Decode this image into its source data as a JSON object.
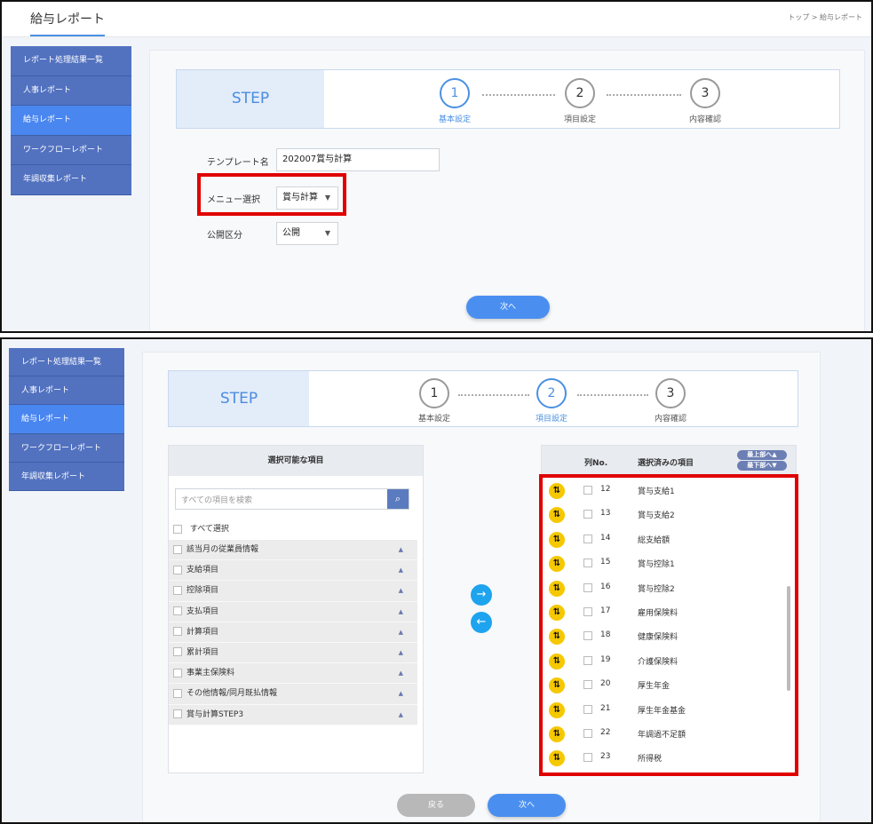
{
  "header": {
    "title": "給与レポート",
    "breadcrumb": "トップ > 給与レポート"
  },
  "sidebar": {
    "items": [
      {
        "label": "レポート処理結果一覧"
      },
      {
        "label": "人事レポート"
      },
      {
        "label": "給与レポート"
      },
      {
        "label": "ワークフローレポート"
      },
      {
        "label": "年調収集レポート"
      }
    ],
    "active_index": 2
  },
  "steps": {
    "label": "STEP",
    "items": [
      {
        "num": "1",
        "name": "基本設定"
      },
      {
        "num": "2",
        "name": "項目設定"
      },
      {
        "num": "3",
        "name": "内容確認"
      }
    ]
  },
  "step1": {
    "current": "1",
    "template_label": "テンプレート名",
    "template_value": "202007賞与計算",
    "menu_label": "メニュー選択",
    "menu_value": "賞与計算",
    "public_label": "公開区分",
    "public_value": "公開",
    "next_label": "次へ"
  },
  "step2": {
    "current": "2",
    "available_title": "選択可能な項目",
    "search_placeholder": "すべての項目を検索",
    "select_all": "すべて選択",
    "categories": [
      "該当月の従業員情報",
      "支給項目",
      "控除項目",
      "支払項目",
      "計算項目",
      "累計項目",
      "事業主保険料",
      "その他情報/同月既払情報",
      "賞与計算STEP3"
    ],
    "selected_col_no": "列No.",
    "selected_title": "選択済みの項目",
    "move_top": "最上部へ▲",
    "move_bottom": "最下部へ▼",
    "selected": [
      {
        "no": "12",
        "name": "賞与支給1"
      },
      {
        "no": "13",
        "name": "賞与支給2"
      },
      {
        "no": "14",
        "name": "総支給額"
      },
      {
        "no": "15",
        "name": "賞与控除1"
      },
      {
        "no": "16",
        "name": "賞与控除2"
      },
      {
        "no": "17",
        "name": "雇用保険料"
      },
      {
        "no": "18",
        "name": "健康保険料"
      },
      {
        "no": "19",
        "name": "介護保険料"
      },
      {
        "no": "20",
        "name": "厚生年金"
      },
      {
        "no": "21",
        "name": "厚生年金基金"
      },
      {
        "no": "22",
        "name": "年調過不足額"
      },
      {
        "no": "23",
        "name": "所得税"
      }
    ],
    "back_label": "戻る",
    "next_label": "次へ"
  },
  "icons": {
    "search": "search-icon",
    "arrow_right": "arrow-right-icon",
    "arrow_left": "arrow-left-icon",
    "reorder": "reorder-handle-icon",
    "caret": "caret-down-icon",
    "collapse": "triangle-up-icon"
  },
  "colors": {
    "accent": "#4a90e2",
    "sidebar": "#5272c0",
    "highlight": "#e00000",
    "handle": "#f5c800"
  }
}
